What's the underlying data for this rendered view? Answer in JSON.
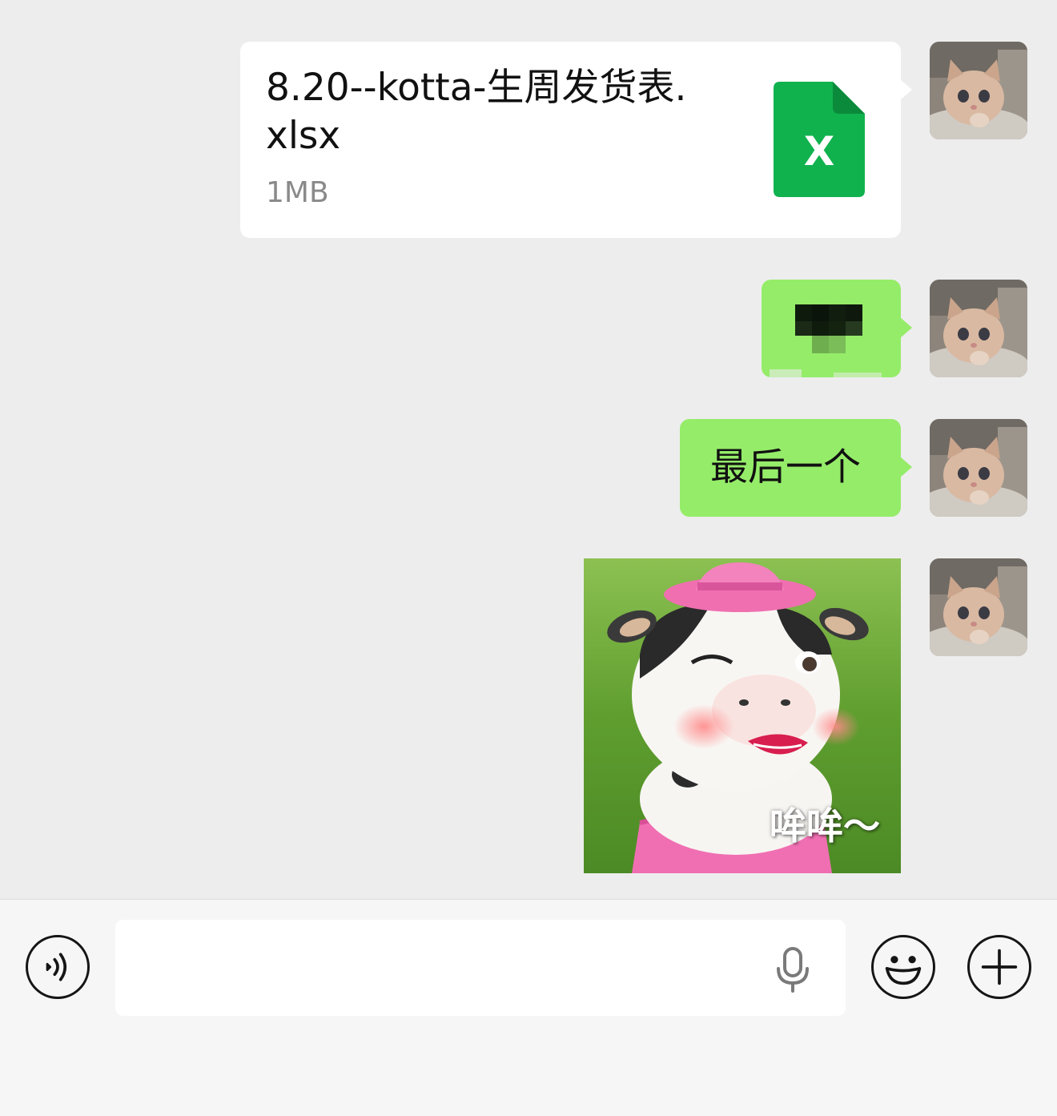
{
  "messages": {
    "file": {
      "name": "8.20--kotta-生周发货表.xlsx",
      "size": "1MB",
      "icon": "excel-file-icon",
      "icon_letter": "X",
      "icon_color": "#10b24e"
    },
    "pixelated": {
      "icon": "pixelated-image-icon"
    },
    "text": {
      "content": "最后一个"
    },
    "sticker": {
      "caption": "哞哞～",
      "icon": "cartoon-cow-sticker"
    }
  },
  "avatar": {
    "icon": "kitten-avatar"
  },
  "input_bar": {
    "voice_icon": "voice-toggle-icon",
    "input_value": "",
    "mic_icon": "microphone-icon",
    "emoji_icon": "emoji-icon",
    "plus_icon": "plus-icon"
  },
  "colors": {
    "chat_background": "#ededed",
    "bubble_self": "#95ec69",
    "bubble_file": "#ffffff",
    "input_bar_background": "#f6f6f6"
  }
}
